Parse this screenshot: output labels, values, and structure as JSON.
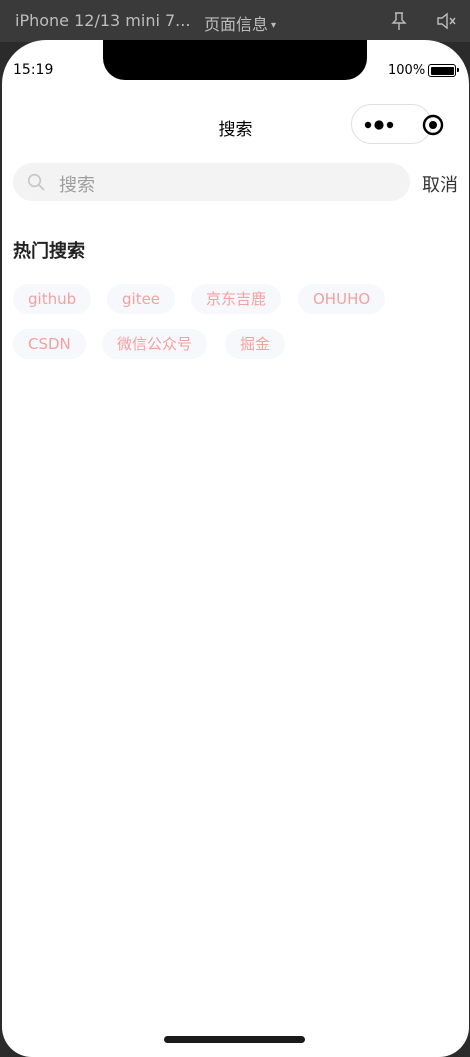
{
  "devtools": {
    "device": "iPhone 12/13 mini 7...",
    "page_info": "页面信息",
    "icons": [
      "pin-icon",
      "mute-icon",
      "caret-down-icon"
    ]
  },
  "status_bar": {
    "time": "15:19",
    "battery": "100%"
  },
  "nav": {
    "title": "搜索",
    "capsule_icons": [
      "more-icon",
      "target-icon"
    ]
  },
  "search": {
    "placeholder": "搜索",
    "cancel_label": "取消"
  },
  "hot_search": {
    "title": "热门搜索",
    "tags": [
      "github",
      "gitee",
      "京东吉鹿",
      "OHUHO",
      "CSDN",
      "微信公众号",
      "掘金"
    ]
  },
  "colors": {
    "tag_text": "#f2a1a1",
    "tag_bg": "#f7f8fc",
    "search_bg": "#f3f3f3"
  }
}
